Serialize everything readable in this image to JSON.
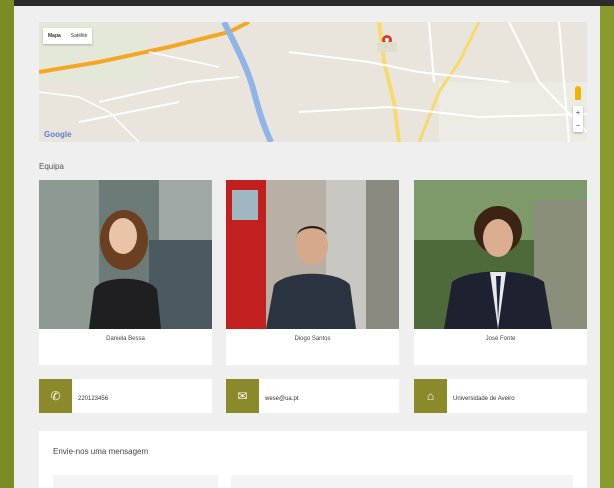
{
  "map": {
    "type_buttons": [
      "Mapa",
      "Satélite"
    ],
    "zoom_in": "+",
    "zoom_out": "−",
    "google_logo": "Google"
  },
  "team": {
    "title": "Equipa",
    "members": [
      {
        "name": "Daniela Bessa"
      },
      {
        "name": "Diogo Santos"
      },
      {
        "name": "José Fonte"
      }
    ]
  },
  "contacts": [
    {
      "icon": "phone-icon",
      "value": "220123456"
    },
    {
      "icon": "mail-icon",
      "value": "wese@ua.pt"
    },
    {
      "icon": "home-icon",
      "value": "Universidade de Aveiro"
    }
  ],
  "form": {
    "title": "Envie-nos uma mensagem"
  },
  "colors": {
    "accent": "#8a8a2a",
    "frame": "#8a9a2e",
    "page_bg": "#efefef"
  }
}
